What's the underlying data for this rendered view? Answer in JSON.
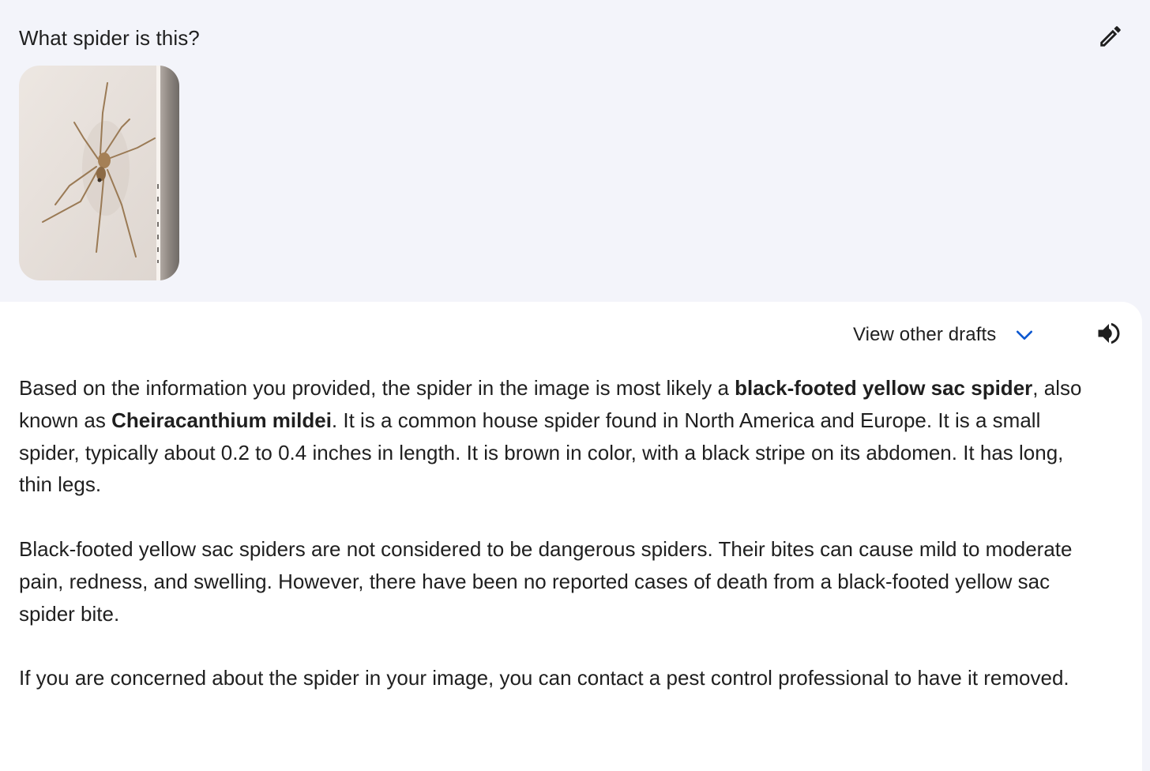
{
  "prompt": {
    "text": "What spider is this?",
    "edit_icon": "pencil-icon",
    "image_subject": "spider on wall"
  },
  "response": {
    "drafts_label": "View other drafts",
    "drafts_icon": "chevron-down-icon",
    "speaker_icon": "volume-icon",
    "paragraphs": [
      {
        "p1_a": "Based on the information you provided, the spider in the image is most likely a ",
        "p1_b": "black-footed yellow sac spider",
        "p1_c": ", also known as ",
        "p1_d": "Cheiracanthium mildei",
        "p1_e": ". It is a common house spider found in North America and Europe. It is a small spider, typically about 0.2 to 0.4 inches in length. It is brown in color, with a black stripe on its abdomen. It has long, thin legs."
      },
      {
        "text": "Black-footed yellow sac spiders are not considered to be dangerous spiders. Their bites can cause mild to moderate pain, redness, and swelling. However, there have been no reported cases of death from a black-footed yellow sac spider bite."
      },
      {
        "text": "If you are concerned about the spider in your image, you can contact a pest control professional to have it removed."
      }
    ]
  },
  "colors": {
    "page_bg": "#f3f4fa",
    "card_bg": "#ffffff",
    "text": "#1f1f1f",
    "accent_blue": "#0b57d0"
  }
}
